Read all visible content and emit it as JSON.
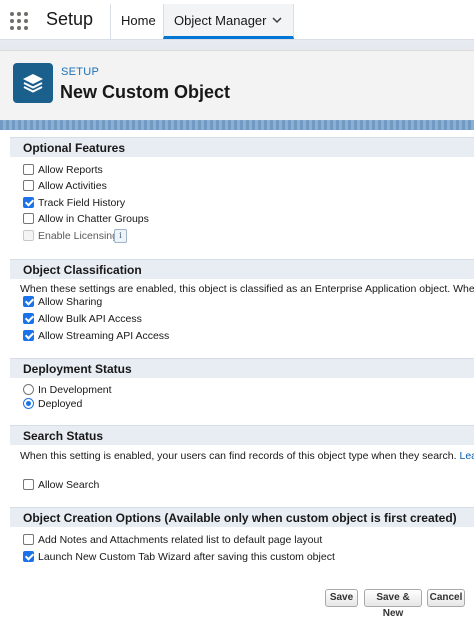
{
  "nav": {
    "app_name": "Setup",
    "tabs": [
      {
        "label": "Home"
      },
      {
        "label": "Object Manager"
      }
    ]
  },
  "header": {
    "eyebrow": "SETUP",
    "title": "New Custom Object",
    "icon": "layers-icon",
    "icon_color": "#1b5f8c"
  },
  "sections": {
    "optional_features": {
      "title": "Optional Features",
      "options": [
        {
          "label": "Allow Reports",
          "checked": false
        },
        {
          "label": "Allow Activities",
          "checked": false
        },
        {
          "label": "Track Field History",
          "checked": true
        },
        {
          "label": "Allow in Chatter Groups",
          "checked": false
        },
        {
          "label": "Enable Licensing",
          "checked": false,
          "disabled": true
        }
      ],
      "info_icon": "i"
    },
    "object_classification": {
      "title": "Object Classification",
      "description": "When these settings are enabled, this object is classified as an Enterprise Application object. When these",
      "options": [
        {
          "label": "Allow Sharing",
          "checked": true
        },
        {
          "label": "Allow Bulk API Access",
          "checked": true
        },
        {
          "label": "Allow Streaming API Access",
          "checked": true
        }
      ]
    },
    "deployment_status": {
      "title": "Deployment Status",
      "options": [
        {
          "label": "In Development",
          "selected": false
        },
        {
          "label": "Deployed",
          "selected": true
        }
      ]
    },
    "search_status": {
      "title": "Search Status",
      "description": "When this setting is enabled, your users can find records of this object type when they search.",
      "link": "Learn mo",
      "options": [
        {
          "label": "Allow Search",
          "checked": false
        }
      ]
    },
    "creation_options": {
      "title": "Object Creation Options (Available only when custom object is first created)",
      "options": [
        {
          "label": "Add Notes and Attachments related list to default page layout",
          "checked": false
        },
        {
          "label": "Launch New Custom Tab Wizard after saving this custom object",
          "checked": true
        }
      ]
    }
  },
  "buttons": {
    "save": "Save",
    "save_new": "Save & New",
    "cancel": "Cancel"
  },
  "colors": {
    "accent": "#1a73e8",
    "section_bg": "#e8edf3"
  }
}
